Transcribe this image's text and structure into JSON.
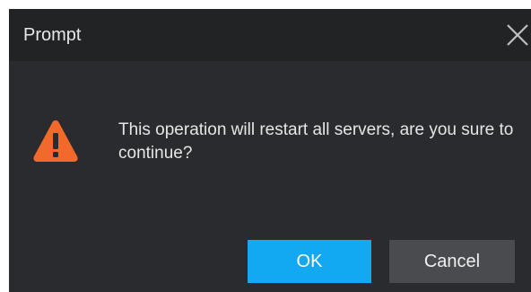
{
  "dialog": {
    "title": "Prompt",
    "message": "This operation will restart all servers, are you sure to continue?",
    "icons": {
      "close": "close-icon",
      "warning": "warning-icon"
    }
  },
  "buttons": {
    "ok_label": "OK",
    "cancel_label": "Cancel"
  },
  "colors": {
    "dialog_bg": "#2a2b2e",
    "titlebar_bg": "#222325",
    "primary": "#13a9f2",
    "secondary": "#4a4b4f",
    "warning": "#f26a2b"
  }
}
